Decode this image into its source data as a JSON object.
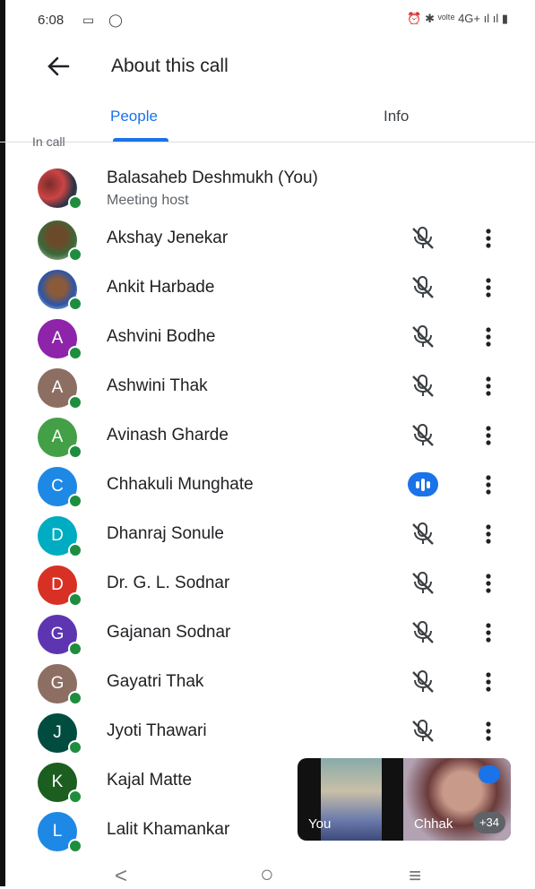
{
  "status": {
    "time": "6:08",
    "left_icons": "▭ ◯",
    "right": "⏰ ✱ ᵛᵒˡᵗᵉ 4G+ ıl ıl ▮"
  },
  "appbar": {
    "title": "About this call",
    "back_icon": "arrow-left-icon"
  },
  "tabs": [
    {
      "label": "People",
      "active": true
    },
    {
      "label": "Info",
      "active": false
    }
  ],
  "section_label": "In call",
  "participants": [
    {
      "name": "Balasaheb Deshmukh (You)",
      "subtitle": "Meeting host",
      "initial": "",
      "color": "photo",
      "mic": "none"
    },
    {
      "name": "Akshay Jenekar",
      "initial": "",
      "color": "photo",
      "mic": "muted"
    },
    {
      "name": "Ankit Harbade",
      "initial": "",
      "color": "photo",
      "mic": "muted"
    },
    {
      "name": "Ashvini Bodhe",
      "initial": "A",
      "color": "#8e24aa",
      "mic": "muted"
    },
    {
      "name": "Ashwini Thak",
      "initial": "A",
      "color": "#8d6e63",
      "mic": "muted"
    },
    {
      "name": "Avinash Gharde",
      "initial": "A",
      "color": "#43a047",
      "mic": "muted"
    },
    {
      "name": "Chhakuli Munghate",
      "initial": "C",
      "color": "#1e88e5",
      "mic": "speaking"
    },
    {
      "name": "Dhanraj Sonule",
      "initial": "D",
      "color": "#00acc1",
      "mic": "muted"
    },
    {
      "name": "Dr. G. L. Sodnar",
      "initial": "D",
      "color": "#d93025",
      "mic": "muted"
    },
    {
      "name": "Gajanan Sodnar",
      "initial": "G",
      "color": "#5e35b1",
      "mic": "muted"
    },
    {
      "name": "Gayatri Thak",
      "initial": "G",
      "color": "#8d6e63",
      "mic": "muted"
    },
    {
      "name": "Jyoti Thawari",
      "initial": "J",
      "color": "#004d40",
      "mic": "muted"
    },
    {
      "name": "Kajal Matte",
      "initial": "K",
      "color": "#1b5e20",
      "mic": "none"
    },
    {
      "name": "Lalit Khamankar",
      "initial": "L",
      "color": "#1e88e5",
      "mic": "none"
    }
  ],
  "pip": {
    "self_label": "You",
    "other_label": "Chhak",
    "extra_count": "+34"
  },
  "navbar": {
    "back": "<",
    "home": "○",
    "recents": "≡"
  }
}
